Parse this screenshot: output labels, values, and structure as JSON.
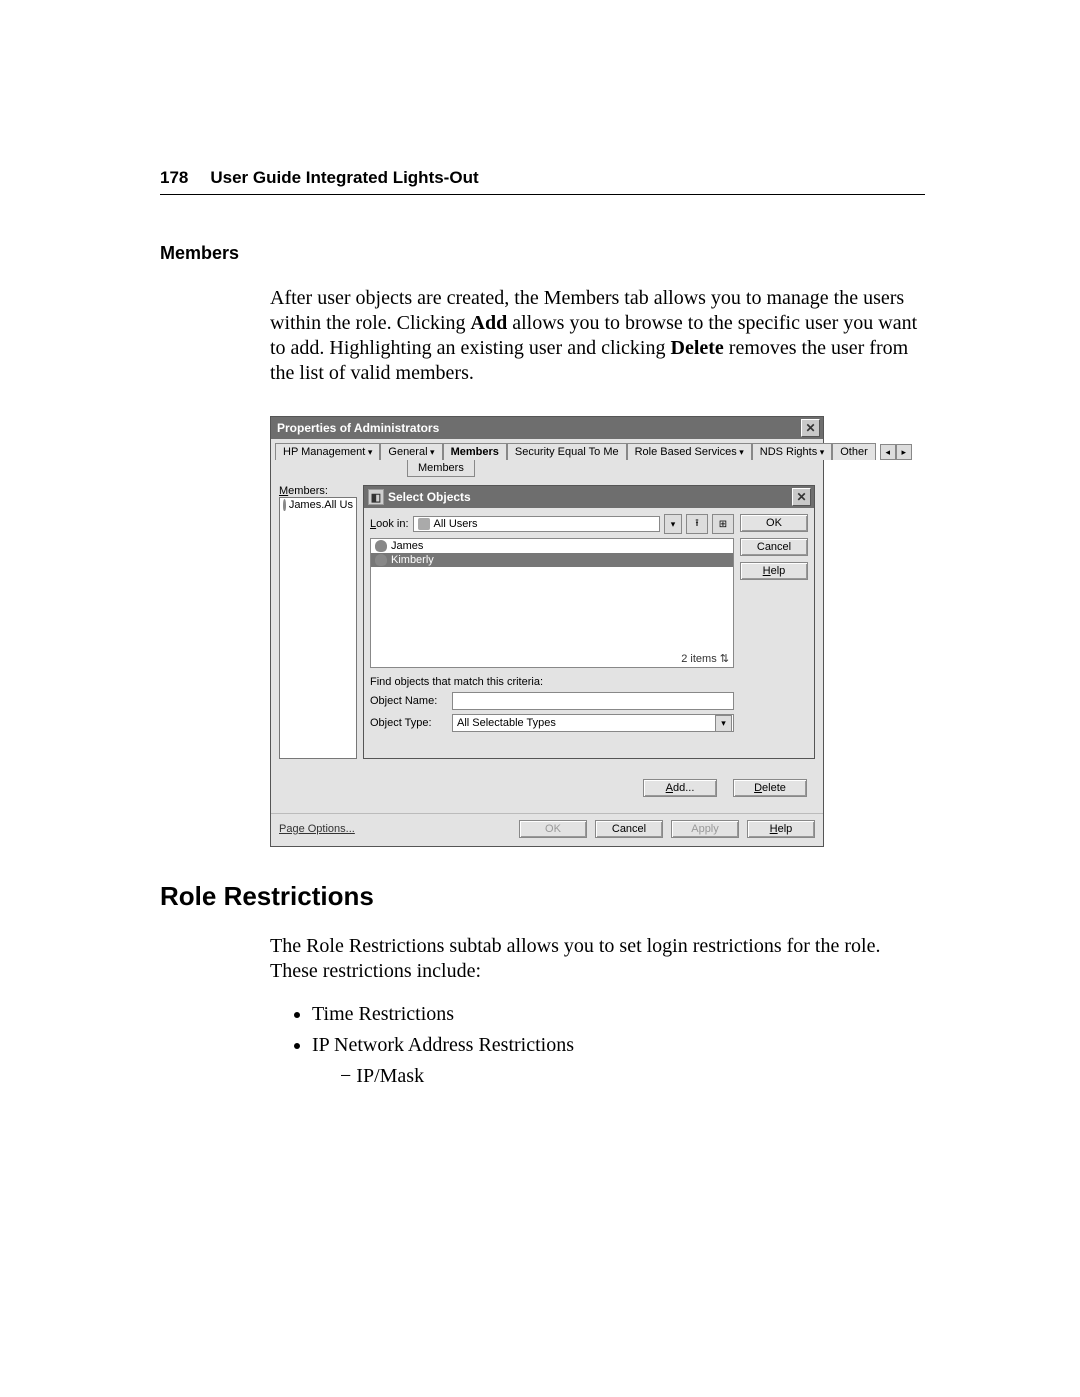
{
  "page": {
    "number": "178",
    "running_head": "User Guide Integrated Lights-Out"
  },
  "section1": {
    "title": "Members",
    "para_before_bold1": "After user objects are created, the Members tab allows you to manage the users within the role. Clicking ",
    "bold1": "Add",
    "para_mid": " allows you to browse to the specific user you want to add. Highlighting an existing user and clicking ",
    "bold2": "Delete",
    "para_after": " removes the user from the list of valid members."
  },
  "dialog": {
    "title": "Properties of Administrators",
    "tabs": [
      "HP Management",
      "General",
      "Members",
      "Security Equal To Me",
      "Role Based Services",
      "NDS Rights",
      "Other"
    ],
    "active_tab": "Members",
    "subtab": "Members",
    "members_label": "Members:",
    "members_list": [
      "James.All Us"
    ],
    "select_objects": {
      "title": "Select Objects",
      "look_in_label": "Look in:",
      "look_in_value": "All Users",
      "list": [
        "James",
        "Kimberly"
      ],
      "selected_index": 1,
      "item_count": "2 items",
      "criteria_label": "Find objects that match this criteria:",
      "object_name_label": "Object Name:",
      "object_name_value": "",
      "object_type_label": "Object Type:",
      "object_type_value": "All Selectable Types",
      "buttons": {
        "ok": "OK",
        "cancel": "Cancel",
        "help": "Help"
      }
    },
    "add_button": "Add...",
    "delete_button": "Delete",
    "footer": {
      "page_options": "Page Options...",
      "ok": "OK",
      "cancel": "Cancel",
      "apply": "Apply",
      "help": "Help"
    }
  },
  "section2": {
    "title": "Role Restrictions",
    "para": "The Role Restrictions subtab allows you to set login restrictions for the role. These restrictions include:",
    "bullets": [
      "Time Restrictions",
      "IP Network Address Restrictions"
    ],
    "sub_bullets": [
      "IP/Mask"
    ]
  }
}
